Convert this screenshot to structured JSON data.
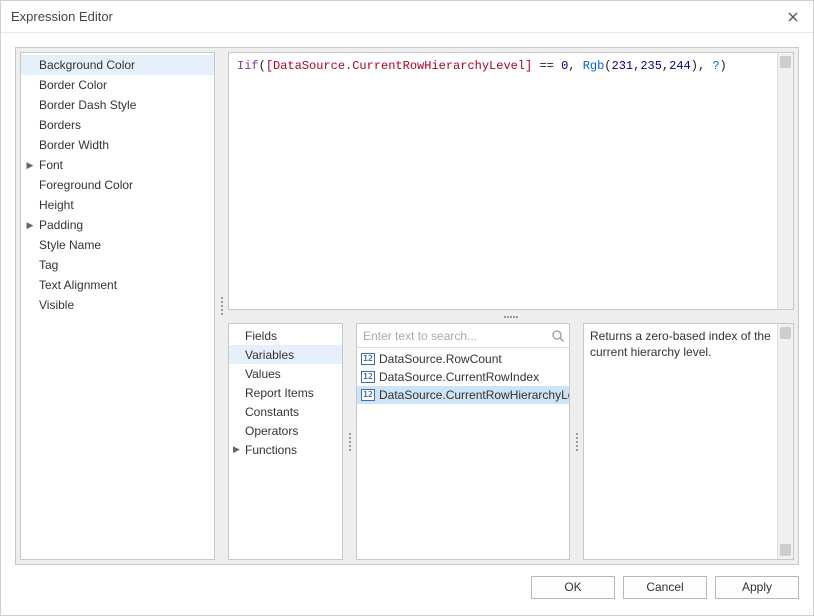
{
  "window": {
    "title": "Expression Editor"
  },
  "properties": {
    "items": [
      {
        "label": "Background Color",
        "expandable": false,
        "selected": true
      },
      {
        "label": "Border Color",
        "expandable": false,
        "selected": false
      },
      {
        "label": "Border Dash Style",
        "expandable": false,
        "selected": false
      },
      {
        "label": "Borders",
        "expandable": false,
        "selected": false
      },
      {
        "label": "Border Width",
        "expandable": false,
        "selected": false
      },
      {
        "label": "Font",
        "expandable": true,
        "selected": false
      },
      {
        "label": "Foreground Color",
        "expandable": false,
        "selected": false
      },
      {
        "label": "Height",
        "expandable": false,
        "selected": false
      },
      {
        "label": "Padding",
        "expandable": true,
        "selected": false
      },
      {
        "label": "Style Name",
        "expandable": false,
        "selected": false
      },
      {
        "label": "Tag",
        "expandable": false,
        "selected": false
      },
      {
        "label": "Text Alignment",
        "expandable": false,
        "selected": false
      },
      {
        "label": "Visible",
        "expandable": false,
        "selected": false
      }
    ]
  },
  "expression": {
    "tokens": [
      {
        "t": "Iif",
        "c": "tok-fn"
      },
      {
        "t": "(",
        "c": "tok-br"
      },
      {
        "t": "[DataSource.CurrentRowHierarchyLevel]",
        "c": "tok-field"
      },
      {
        "t": " == ",
        "c": "tok-op"
      },
      {
        "t": "0",
        "c": "tok-num"
      },
      {
        "t": ", ",
        "c": "tok-op"
      },
      {
        "t": "Rgb",
        "c": "tok-kw"
      },
      {
        "t": "(",
        "c": "tok-br"
      },
      {
        "t": "231",
        "c": "tok-num"
      },
      {
        "t": ",",
        "c": "tok-op"
      },
      {
        "t": "235",
        "c": "tok-num"
      },
      {
        "t": ",",
        "c": "tok-op"
      },
      {
        "t": "244",
        "c": "tok-num"
      },
      {
        "t": ")",
        "c": "tok-br"
      },
      {
        "t": ", ",
        "c": "tok-op"
      },
      {
        "t": "?",
        "c": "tok-kw"
      },
      {
        "t": ")",
        "c": "tok-br"
      }
    ]
  },
  "categories": {
    "items": [
      {
        "label": "Fields",
        "expandable": false,
        "selected": false
      },
      {
        "label": "Variables",
        "expandable": false,
        "selected": true
      },
      {
        "label": "Values",
        "expandable": false,
        "selected": false
      },
      {
        "label": "Report Items",
        "expandable": false,
        "selected": false
      },
      {
        "label": "Constants",
        "expandable": false,
        "selected": false
      },
      {
        "label": "Operators",
        "expandable": false,
        "selected": false
      },
      {
        "label": "Functions",
        "expandable": true,
        "selected": false
      }
    ]
  },
  "search": {
    "placeholder": "Enter text to search..."
  },
  "variables": {
    "items": [
      {
        "label": "DataSource.RowCount",
        "selected": false
      },
      {
        "label": "DataSource.CurrentRowIndex",
        "selected": false
      },
      {
        "label": "DataSource.CurrentRowHierarchyLevel",
        "selected": true
      }
    ],
    "icon_glyph": "12"
  },
  "description": {
    "text": "Returns a zero-based index of the current hierarchy level."
  },
  "buttons": {
    "ok": "OK",
    "cancel": "Cancel",
    "apply": "Apply"
  }
}
